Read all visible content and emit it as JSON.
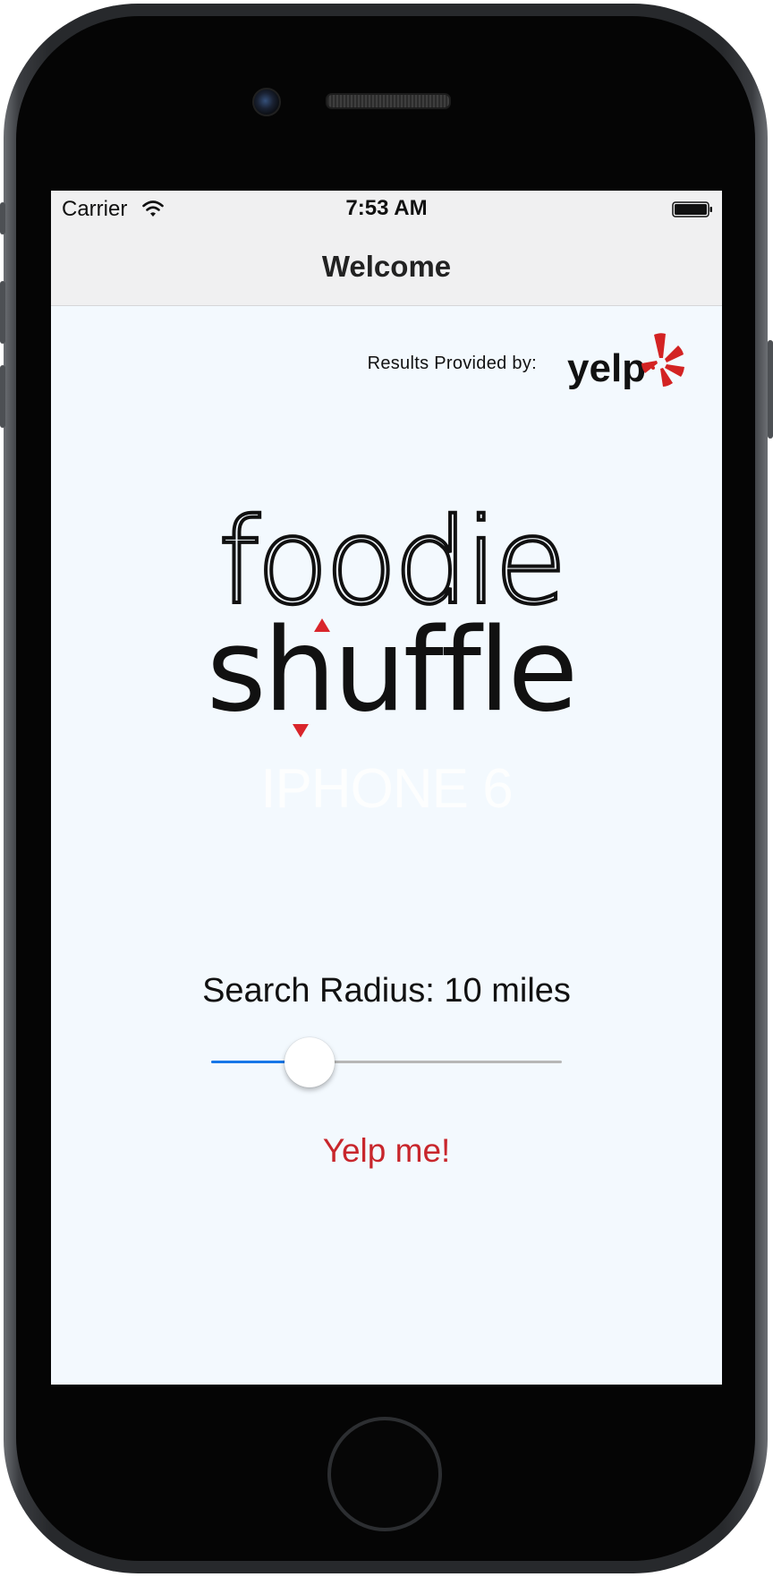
{
  "status_bar": {
    "carrier": "Carrier",
    "time": "7:53 AM",
    "icons": [
      "wifi-icon",
      "battery-icon"
    ]
  },
  "nav": {
    "title": "Welcome"
  },
  "attribution": {
    "text": "Results Provided by:",
    "logo_word": "yelp",
    "logo_color": "#c8262c"
  },
  "logo": {
    "line1": "foodie",
    "line2": "shuffle",
    "accent_color": "#d9252b"
  },
  "watermark": "IPHONE 6",
  "search": {
    "label": "Search Radius: 10 miles",
    "slider_value_fraction": 0.28,
    "fill_color": "#1777e8"
  },
  "action": {
    "label": "Yelp me!",
    "color": "#c8262c"
  }
}
